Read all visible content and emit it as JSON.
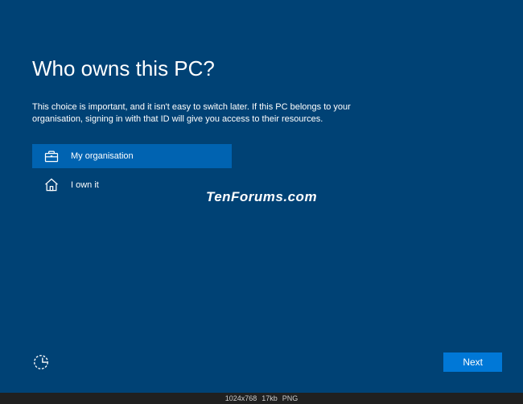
{
  "screen": {
    "title": "Who owns this PC?",
    "description": "This choice is important, and it isn't easy to switch later. If this PC belongs to your organisation, signing in with that ID will give you access to their resources.",
    "options": [
      {
        "label": "My organisation",
        "selected": true
      },
      {
        "label": "I own it",
        "selected": false
      }
    ],
    "next_label": "Next",
    "watermark": "TenForums.com"
  },
  "statusbar": {
    "dimensions": "1024x768",
    "filesize": "17kb",
    "format": "PNG"
  }
}
